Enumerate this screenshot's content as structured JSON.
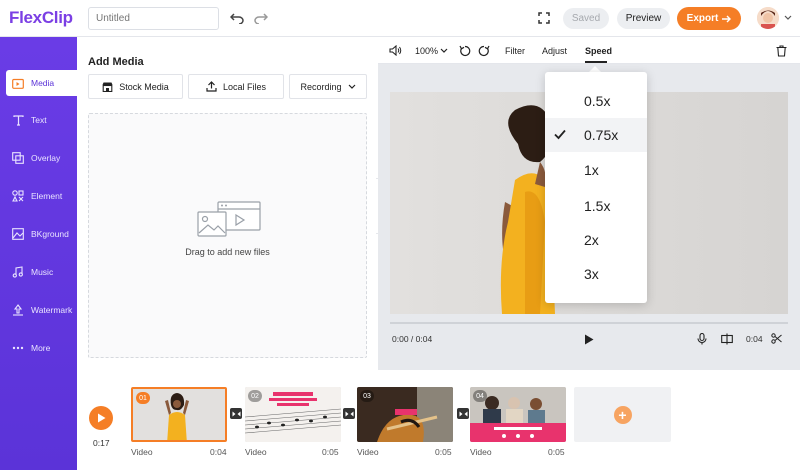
{
  "header": {
    "logo_text": "FlexClip",
    "project_name_placeholder": "Untitled",
    "saved_label": "Saved",
    "preview_label": "Preview",
    "export_label": "Export"
  },
  "sidebar": {
    "items": [
      {
        "label": "Media",
        "icon": "media-icon",
        "active": true
      },
      {
        "label": "Text",
        "icon": "text-icon"
      },
      {
        "label": "Overlay",
        "icon": "overlay-icon"
      },
      {
        "label": "Element",
        "icon": "element-icon"
      },
      {
        "label": "BKground",
        "icon": "background-icon"
      },
      {
        "label": "Music",
        "icon": "music-icon"
      },
      {
        "label": "Watermark",
        "icon": "watermark-icon"
      },
      {
        "label": "More",
        "icon": "more-icon"
      }
    ]
  },
  "media_panel": {
    "title": "Add Media",
    "stock_media_label": "Stock Media",
    "local_files_label": "Local Files",
    "recording_label": "Recording",
    "drop_text": "Drag to add new files"
  },
  "toolbar": {
    "zoom": "100%",
    "filter_label": "Filter",
    "adjust_label": "Adjust",
    "speed_label": "Speed"
  },
  "player": {
    "current_time": "0:00 / 0:04",
    "duration": "0:04"
  },
  "speed_menu": {
    "options": [
      "0.5x",
      "0.75x",
      "1x",
      "1.5x",
      "2x",
      "3x"
    ],
    "selected": "0.75x"
  },
  "timeline": {
    "total_time": "0:17",
    "clips": [
      {
        "num": "01",
        "label": "Video",
        "duration": "0:04"
      },
      {
        "num": "02",
        "label": "Video",
        "duration": "0:05"
      },
      {
        "num": "03",
        "label": "Video",
        "duration": "0:05"
      },
      {
        "num": "04",
        "label": "Video",
        "duration": "0:05"
      }
    ]
  },
  "colors": {
    "brand_purple": "#6a3ce6",
    "accent_orange": "#f57e26"
  }
}
